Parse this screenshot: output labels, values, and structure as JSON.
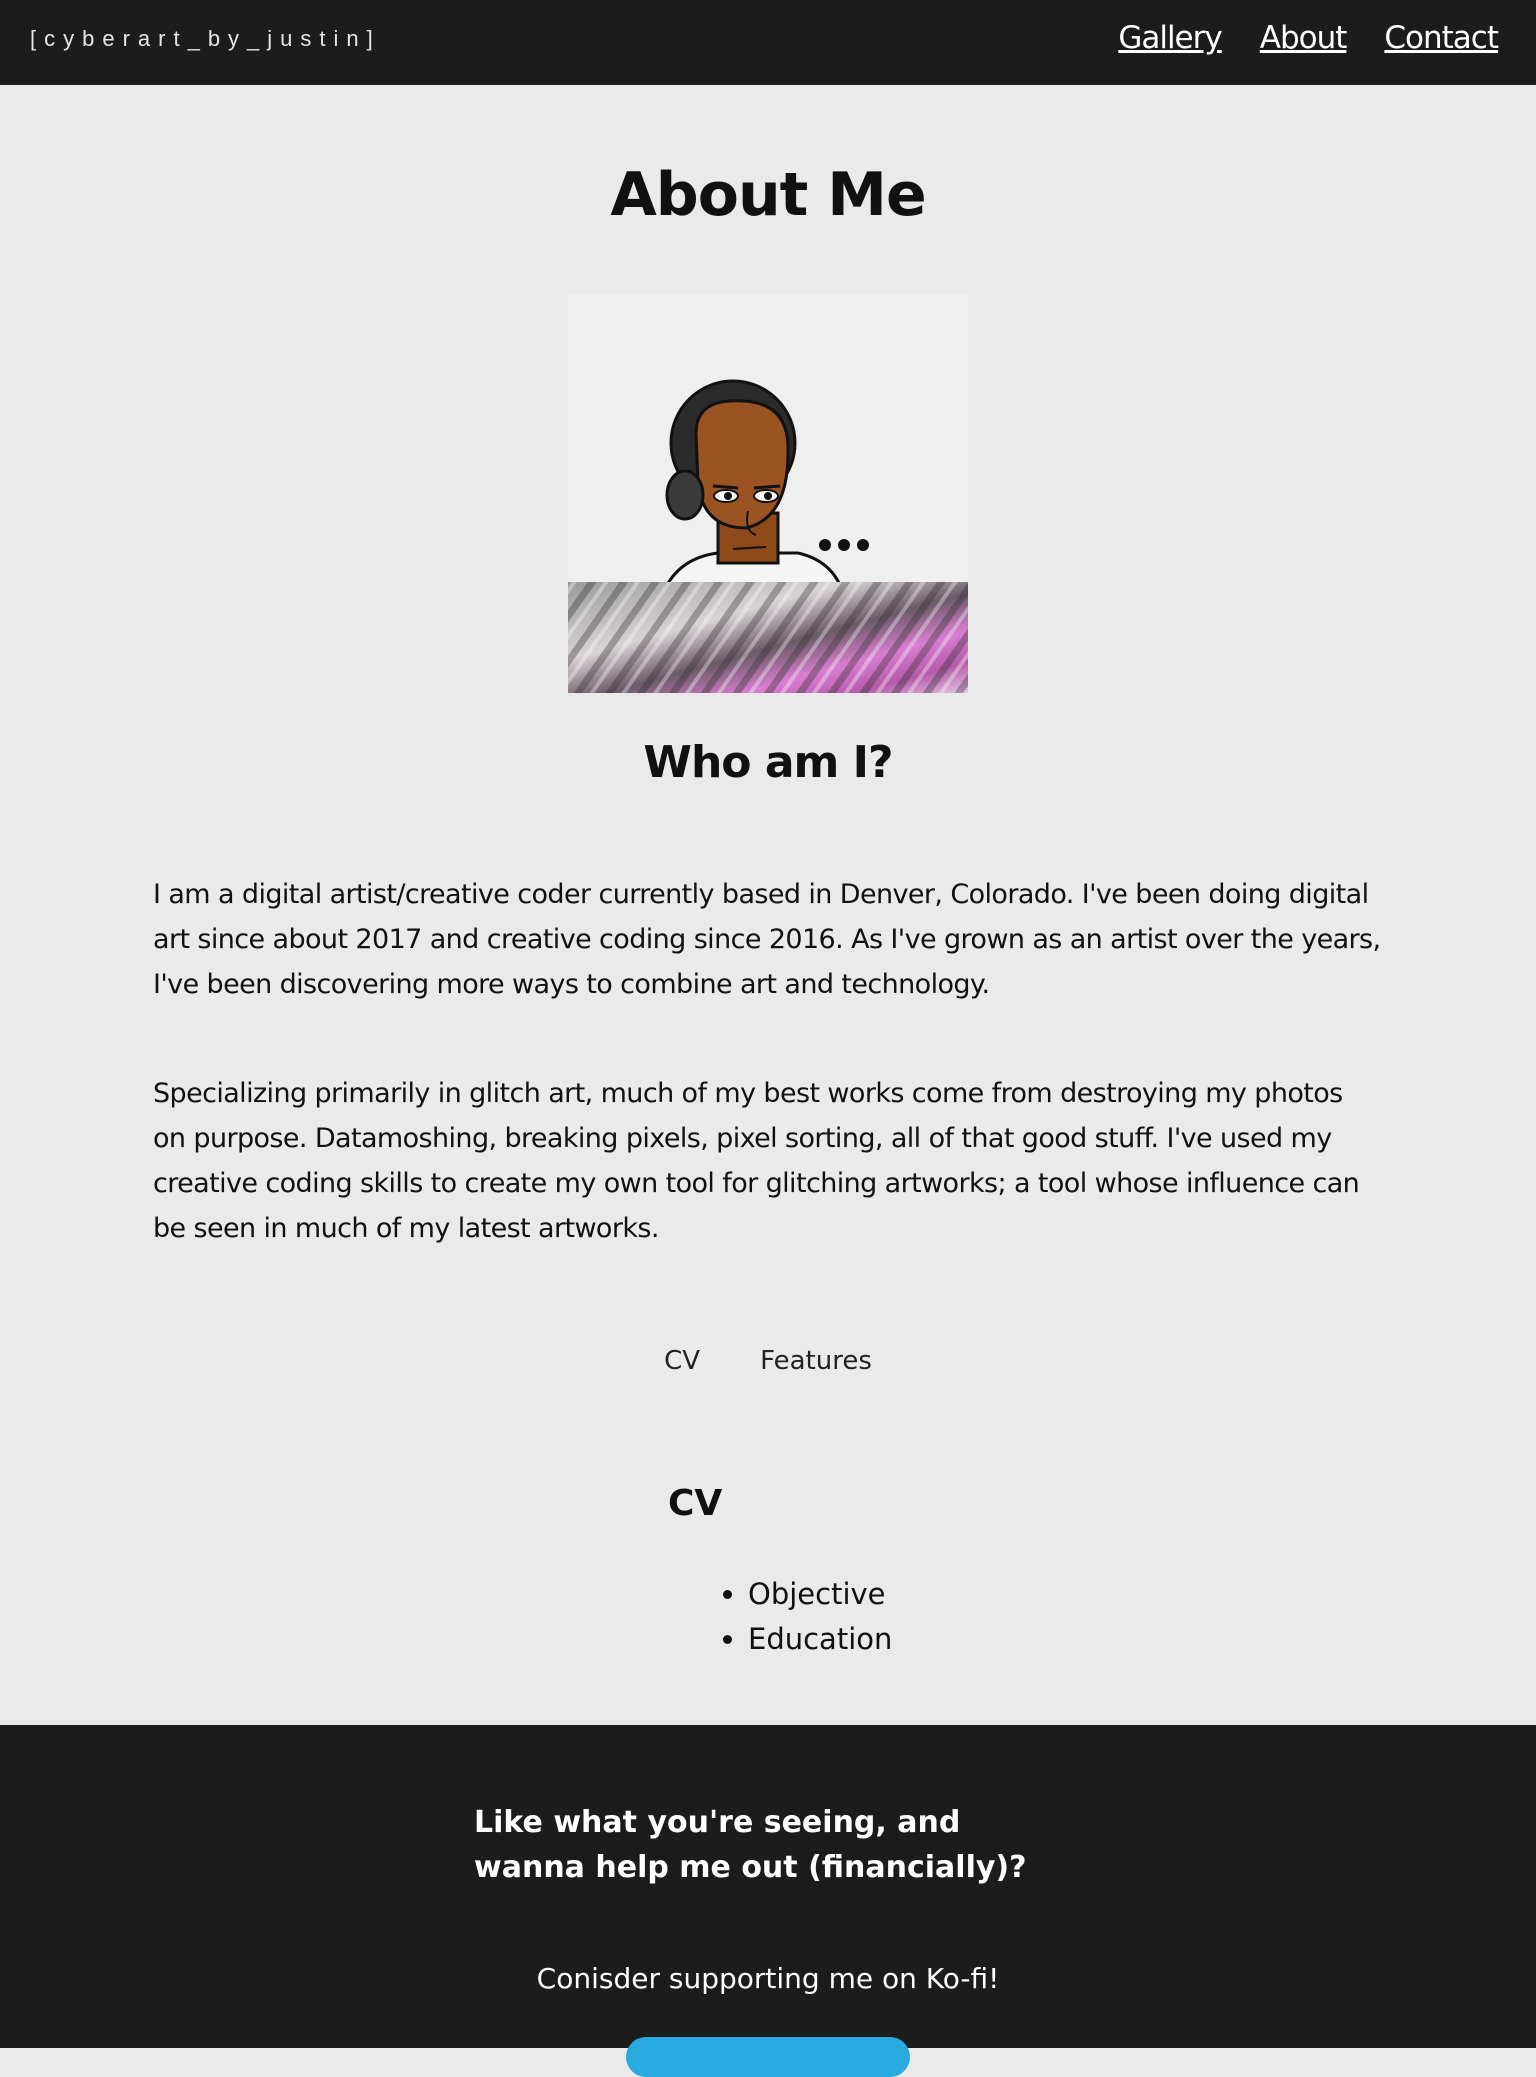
{
  "header": {
    "logo": "[cyberart_by_justin]",
    "nav": [
      "Gallery",
      "About",
      "Contact"
    ]
  },
  "page": {
    "title": "About Me",
    "avatar_icon": "bitmoji-avatar-with-headphones",
    "subtitle": "Who am I?",
    "bio": [
      "I am a digital artist/creative coder currently based in Denver, Colorado. I've been doing digital art since about 2017 and creative coding since 2016. As I've grown as an artist over the years, I've been discovering more ways to combine art and technology.",
      "Specializing primarily in glitch art, much of my best works come from destroying my photos on purpose. Datamoshing, breaking pixels, pixel sorting, all of that good stuff. I've used my creative coding skills to create my own tool for glitching artworks; a tool whose influence can be seen in much of my latest artworks."
    ],
    "tabs": [
      "CV",
      "Features"
    ],
    "cv": {
      "heading": "CV",
      "items": [
        "Objective",
        "Education"
      ]
    }
  },
  "footer": {
    "prompt": "Like what you're seeing, and wanna help me out (financially)?",
    "support": "Conisder supporting me on Ko-fi!",
    "kofi_color": "#29abe0"
  },
  "colors": {
    "bar": "#1c1c1c",
    "background": "#eaeaea"
  }
}
